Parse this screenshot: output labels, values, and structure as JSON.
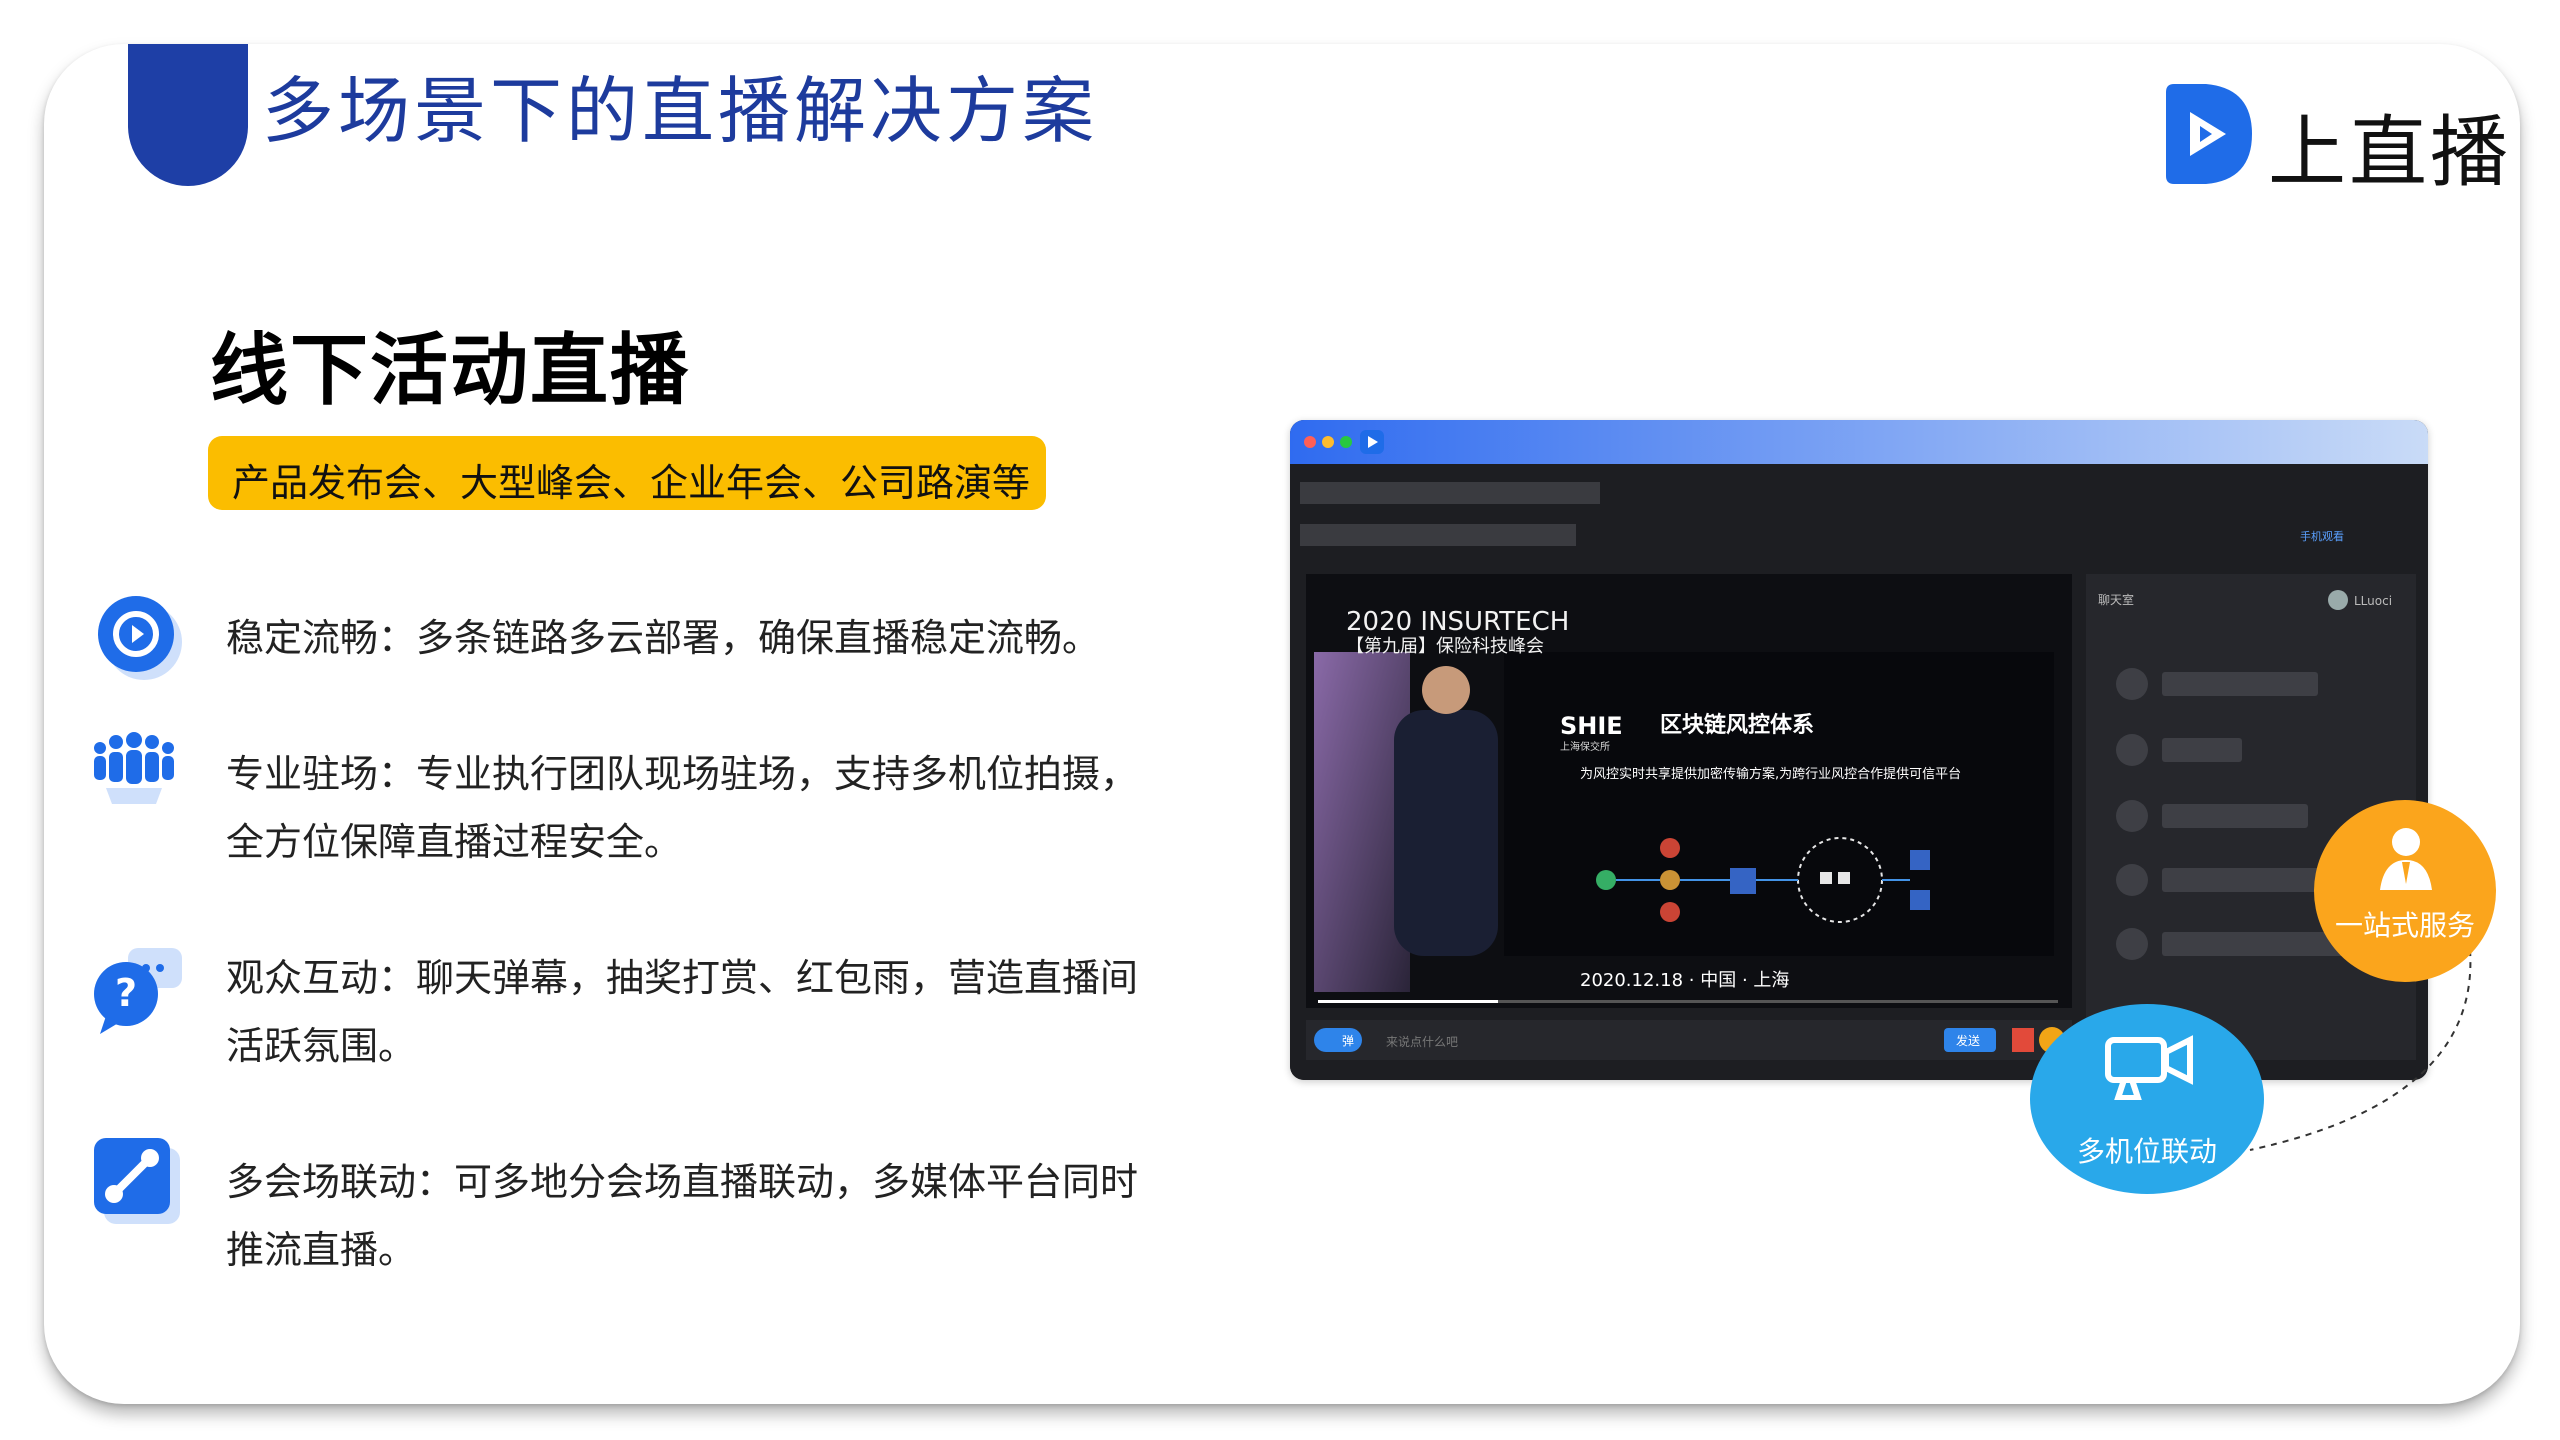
{
  "page": {
    "title": "多场景下的直播解决方案",
    "brand_name": "上直播"
  },
  "section": {
    "heading": "线下活动直播",
    "tag": "产品发布会、大型峰会、企业年会、公司路演等"
  },
  "features": [
    {
      "icon": "stable-stream-icon",
      "line1": "稳定流畅：多条链路多云部署，确保直播稳定流畅。",
      "line2": ""
    },
    {
      "icon": "team-icon",
      "line1": "专业驻场：专业执行团队现场驻场，支持多机位拍摄，",
      "line2": "全方位保障直播过程安全。"
    },
    {
      "icon": "chat-question-icon",
      "line1": "观众互动：聊天弹幕，抽奖打赏、红包雨，营造直播间",
      "line2": "活跃氛围。"
    },
    {
      "icon": "link-icon",
      "line1": "多会场联动：可多地分会场直播联动，多媒体平台同时",
      "line2": "推流直播。"
    }
  ],
  "screenshot": {
    "event_title": "2020 INSURTECH",
    "event_subtitle": "【第九届】保险科技峰会",
    "organizer": "SHIE",
    "organizer_sub": "上海保交所",
    "slide_title": "区块链风控体系",
    "slide_caption": "为风控实时共享提供加密传输方案,为跨行业风控合作提供可信平台",
    "date_line": "2020.12.18 · 中国 · 上海",
    "chat_tab": "聊天室",
    "user_name": "LLuoci",
    "mobile_watch": "手机观看",
    "chat_placeholder": "来说点什么吧",
    "send_label": "发送",
    "barrage_label": "弹"
  },
  "bubbles": {
    "service": "一站式服务",
    "multicam": "多机位联动"
  },
  "colors": {
    "title_blue": "#1d3b9d",
    "tag_yellow": "#fbbd00",
    "bubble_orange": "#fba51c",
    "bubble_blue": "#29a8ea",
    "icon_blue": "#1f6ce8"
  }
}
